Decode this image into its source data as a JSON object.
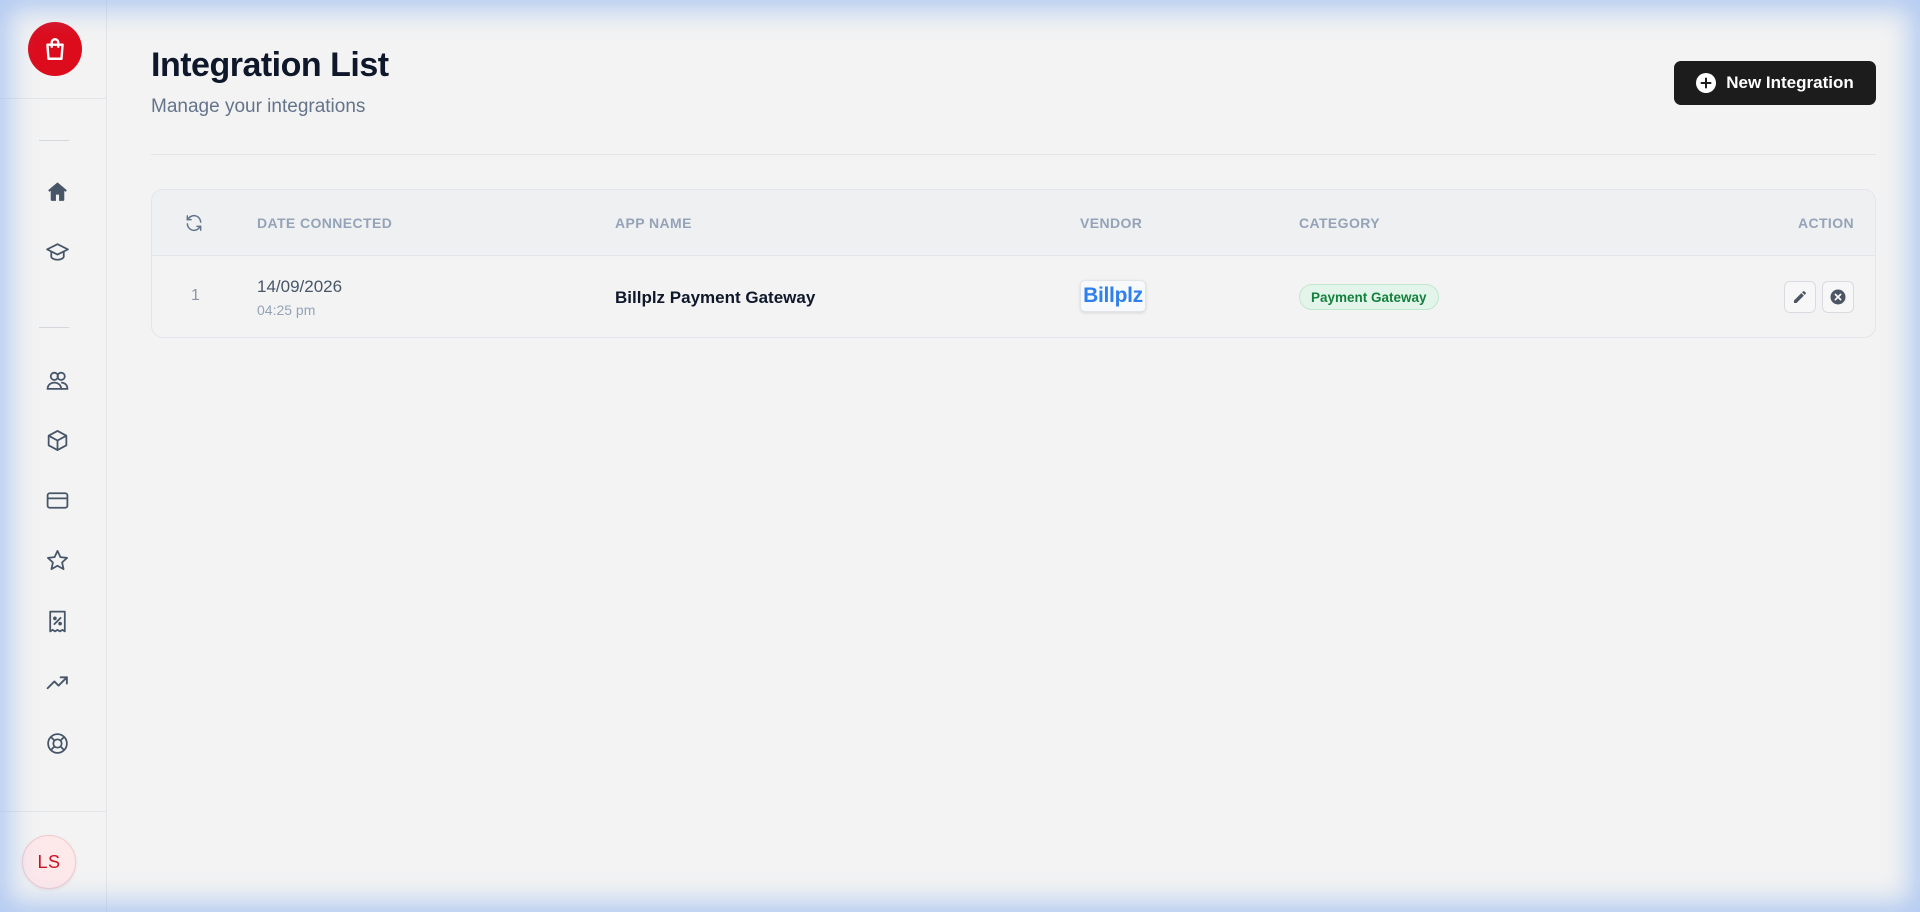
{
  "sidebar": {
    "logo_icon": "shopping-bag-icon",
    "brand_color": "#dc0c1d",
    "nav_items": [
      {
        "icon": "home-icon"
      },
      {
        "icon": "graduation-cap-icon"
      },
      {
        "icon": "users-icon"
      },
      {
        "icon": "box-icon"
      },
      {
        "icon": "credit-card-icon"
      },
      {
        "icon": "star-icon"
      },
      {
        "icon": "receipt-icon"
      },
      {
        "icon": "trending-up-icon"
      },
      {
        "icon": "lifebuoy-icon"
      }
    ],
    "avatar_initials": "LS"
  },
  "header": {
    "title": "Integration List",
    "subtitle": "Manage your integrations",
    "new_button_label": "New Integration"
  },
  "table": {
    "columns": {
      "date": "DATE CONNECTED",
      "app": "APP NAME",
      "vendor": "VENDOR",
      "category": "CATEGORY",
      "action": "ACTION"
    },
    "rows": [
      {
        "index": "1",
        "date": "14/09/2026",
        "time": "04:25 pm",
        "app_name": "Billplz Payment Gateway",
        "vendor_logo_text": "Billplz",
        "category": "Payment Gateway"
      }
    ]
  },
  "colors": {
    "accent_dark": "#1c1c1c",
    "category_badge_text": "#15803d",
    "vendor_logo": "#2f80ed"
  }
}
